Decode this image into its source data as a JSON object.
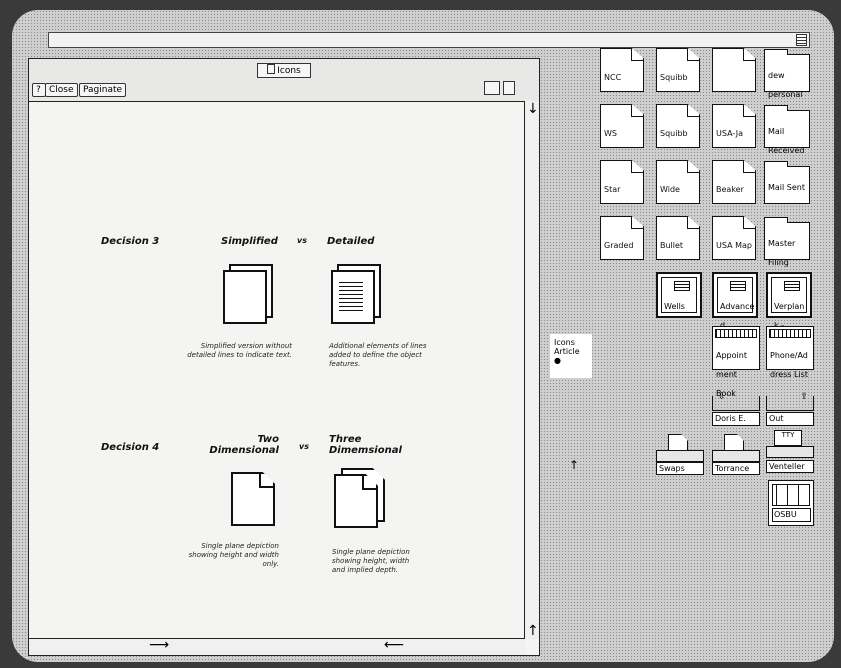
{
  "window": {
    "title": "Icons",
    "buttons": {
      "help": "?",
      "close": "Close",
      "paginate": "Paginate"
    }
  },
  "doc": {
    "decision3": {
      "label": "Decision 3",
      "left_title": "Simplified",
      "vs": "vs",
      "right_title": "Detailed",
      "left_caption": "Simplified version without detailed lines to indicate text.",
      "right_caption": "Additional elements of lines added to define the object features."
    },
    "decision4": {
      "label": "Decision 4",
      "left_title": "Two Dimensional",
      "vs": "vs",
      "right_title": "Three Dimemsional",
      "left_caption": "Single plane depiction showing height and width only.",
      "right_caption": "Single plane depiction showing height, width and implied depth."
    }
  },
  "desktop": {
    "icons": {
      "ncc": "NCC Demo Doc",
      "squibb1": "Squibb Corpor ation",
      "blank": "",
      "dew": "dew personal",
      "ws": "WS Diagra m",
      "squibb2": "Squibb Corpor ation",
      "usajapan": "USA-Ja pan Conf.",
      "mailrec": "Mail Received",
      "star": "Star Docum ents",
      "wide": "Wide Table",
      "beaker": "Beaker Graph",
      "mailsent": "Mail Sent",
      "graded": "Graded Chart",
      "bullet": "Bullet Slide",
      "usamap": "USA Map",
      "master": "Master Filing Folder",
      "wells": "Wells",
      "advanced": "Advance d",
      "verplank": "Verplan k - Puck",
      "appt": "Appoint ment Book",
      "phone": "Phone/Ad dress List",
      "doris": "Doris E.",
      "out": "Out",
      "swaps": "Swaps",
      "torrance": "Torrance",
      "venteller": "Venteller",
      "osbu": "OSBU"
    },
    "note": {
      "line1": "Icons",
      "line2": "Article"
    }
  }
}
